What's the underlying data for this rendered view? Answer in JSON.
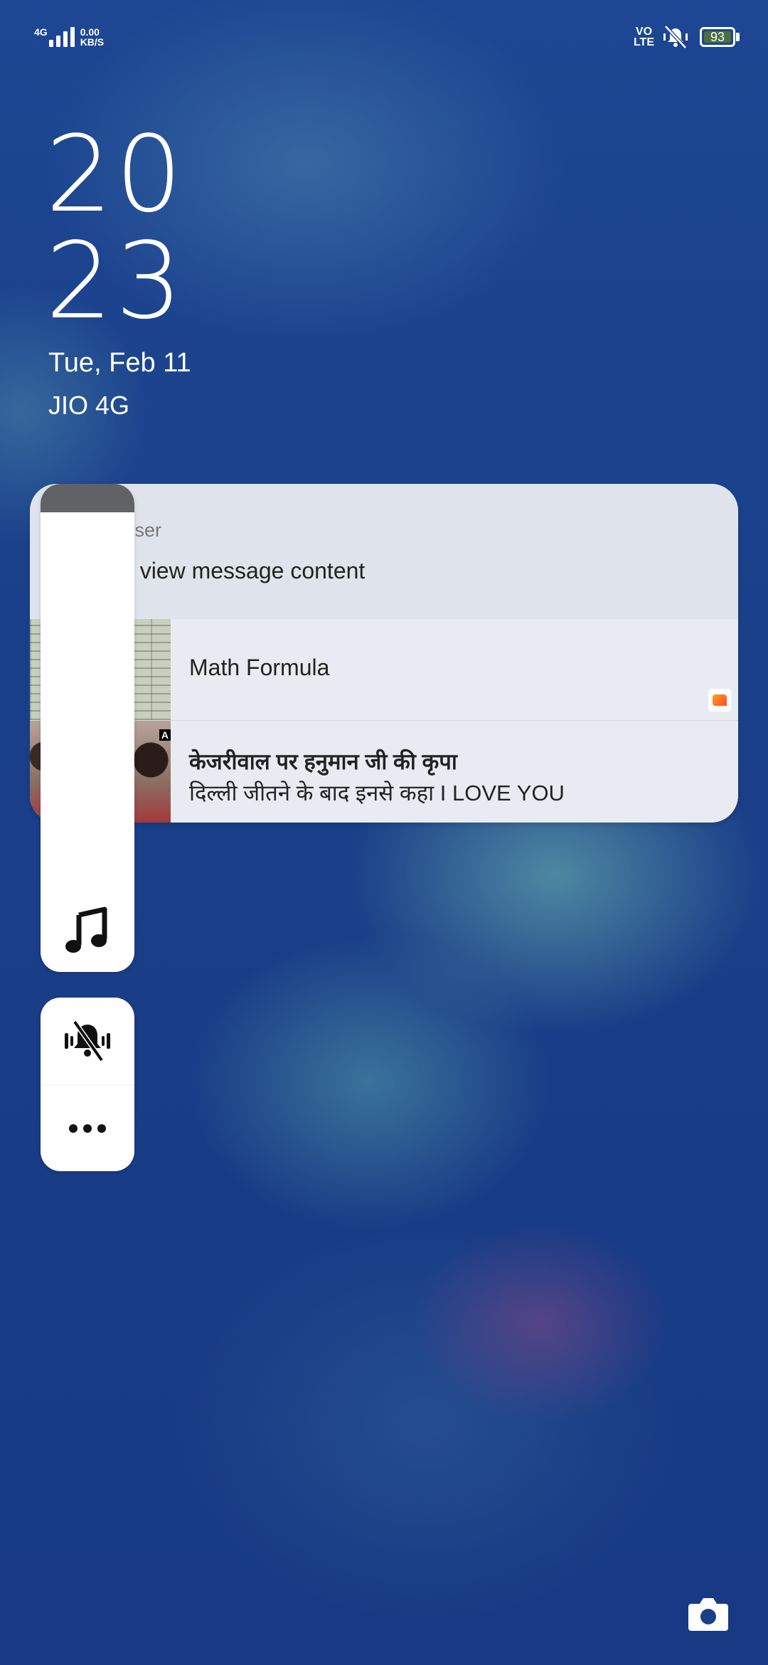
{
  "status_bar": {
    "network_type": "4G",
    "data_speed_value": "0.00",
    "data_speed_unit": "KB/S",
    "volte_line1": "VO",
    "volte_line2": "LTE",
    "battery_level": "93",
    "icons": [
      "signal-icon",
      "mute-vibrate-icon",
      "battery-icon"
    ]
  },
  "lockscreen": {
    "hour": "20",
    "minute": "23",
    "date": "Tue, Feb 11",
    "carrier": "JIO 4G"
  },
  "notifications": {
    "browser": {
      "app_name": "wser",
      "message": "o view message content"
    },
    "news": [
      {
        "title": "Math Formula",
        "subtitle": ""
      },
      {
        "title": "केजरीवाल पर हनुमान जी की कृपा",
        "subtitle": "दिल्ली जीतने के बाद इनसे कहा I LOVE YOU",
        "badge": "A"
      }
    ]
  },
  "side_panel": {
    "buttons": [
      "music-icon",
      "vibrate-mute-icon",
      "more-icon"
    ]
  },
  "colors": {
    "wallpaper": "#1c3f8a",
    "card_background": "#e8ebf1",
    "battery_fill": "#4c6f3e",
    "news_icon_accent": "#ff6a2a"
  }
}
